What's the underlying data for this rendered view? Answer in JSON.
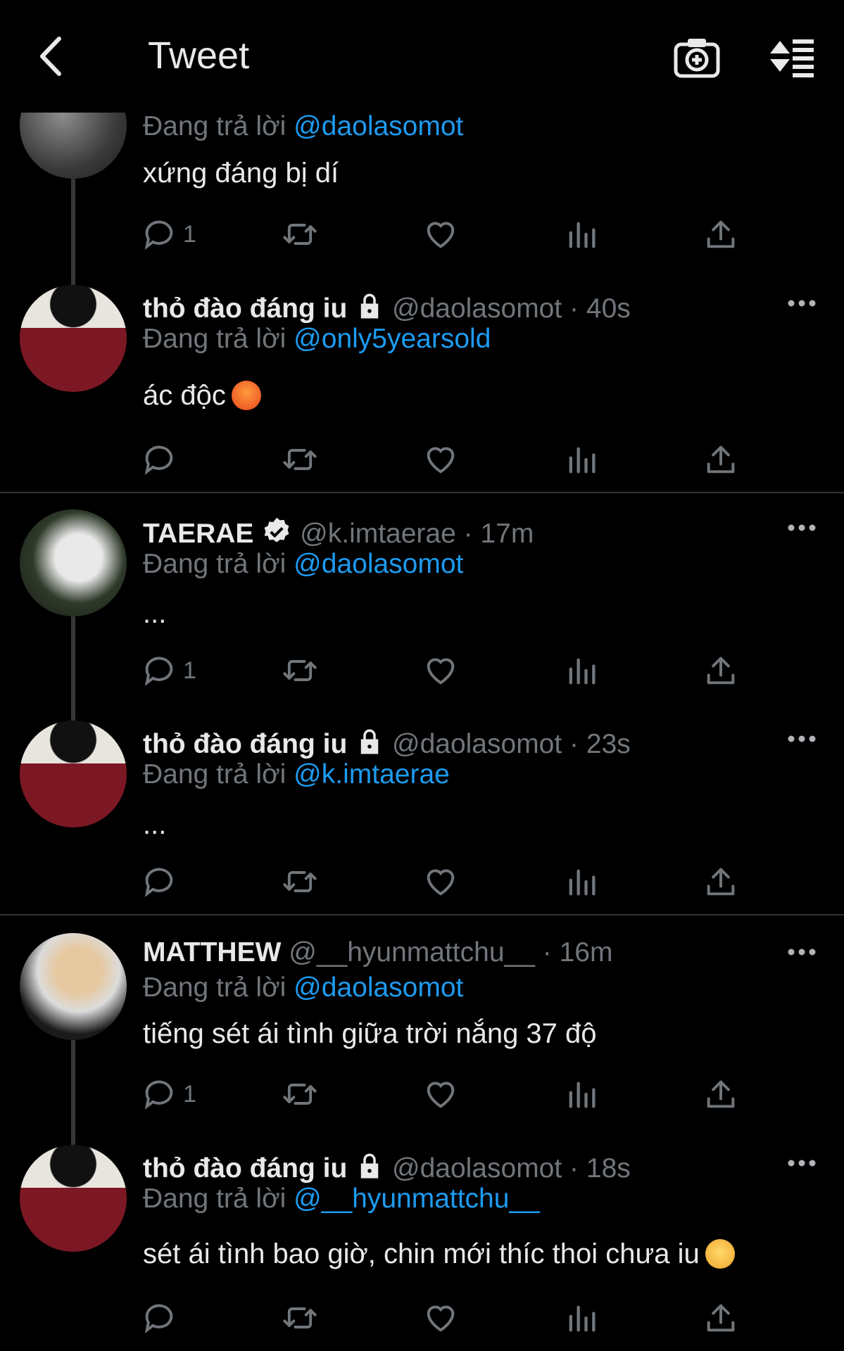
{
  "header": {
    "title": "Tweet"
  },
  "reply_prefix": "Đang trả lời",
  "tweets": [
    {
      "reply_to": "@daolasomot",
      "text": "xứng đáng bị dí",
      "replies": "1"
    },
    {
      "name": "thỏ đào đáng iu",
      "handle": "@daolasomot",
      "time": "40s",
      "reply_to": "@only5yearsold",
      "text": "ác độc"
    },
    {
      "name": "TAERAE",
      "handle": "@k.imtaerae",
      "time": "17m",
      "reply_to": "@daolasomot",
      "text": "...",
      "replies": "1"
    },
    {
      "name": "thỏ đào đáng iu",
      "handle": "@daolasomot",
      "time": "23s",
      "reply_to": "@k.imtaerae",
      "text": "..."
    },
    {
      "name": "MATTHEW",
      "handle": "@__hyunmattchu__",
      "time": "16m",
      "reply_to": "@daolasomot",
      "text": "tiếng sét ái tình giữa trời nắng 37 độ",
      "replies": "1"
    },
    {
      "name": "thỏ đào đáng iu",
      "handle": "@daolasomot",
      "time": "18s",
      "reply_to": "@__hyunmattchu__",
      "text": "sét ái tình bao giờ, chin mới thíc thoi chưa iu"
    }
  ],
  "colors": {
    "background": "#000000",
    "text": "#e7e9ea",
    "muted": "#71767b",
    "accent": "#1d9bf0",
    "divider": "#2f3336"
  },
  "icons": [
    "back-arrow-icon",
    "camera-plus-icon",
    "sort-icon",
    "reply-icon",
    "retweet-icon",
    "like-icon",
    "analytics-icon",
    "share-icon",
    "more-icon",
    "lock-icon",
    "verified-icon"
  ]
}
